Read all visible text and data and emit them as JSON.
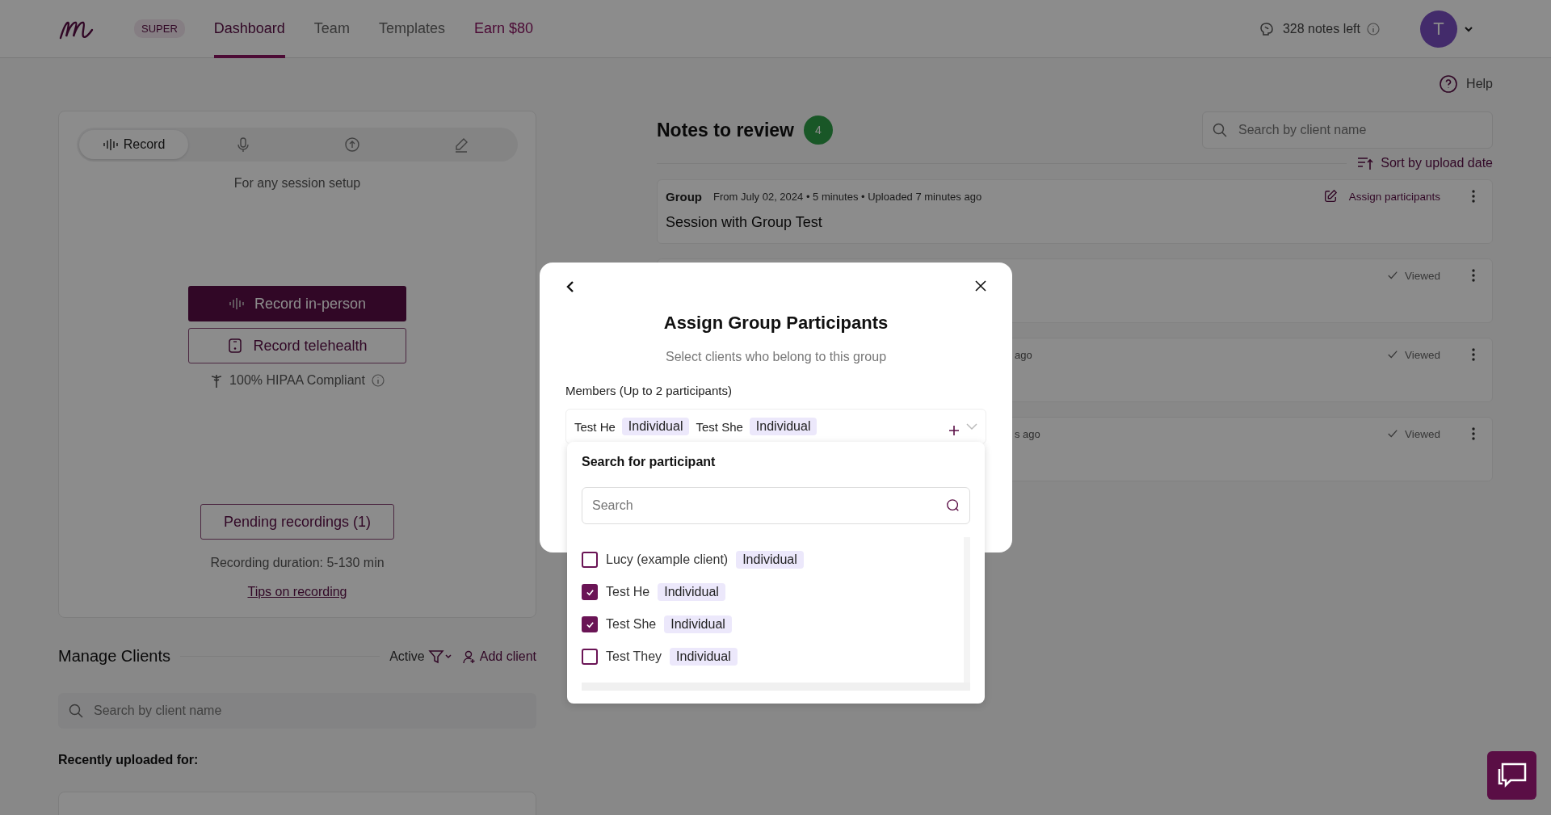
{
  "nav": {
    "badge": "SUPER",
    "tabs": [
      {
        "label": "Dashboard",
        "selected": true
      },
      {
        "label": "Team",
        "selected": false
      },
      {
        "label": "Templates",
        "selected": false
      }
    ],
    "promo_link": "Earn $80",
    "notes_left": "328 notes left",
    "avatar": "T"
  },
  "help": "Help",
  "recorder": {
    "modes": [
      {
        "kind": "waveform",
        "label": "Record",
        "selected": true
      },
      {
        "kind": "mic",
        "selected": false
      },
      {
        "kind": "upload",
        "selected": false
      },
      {
        "kind": "pen",
        "selected": false
      }
    ],
    "caption": "For any session setup",
    "primary_button": "Record in-person",
    "secondary_button": "Record telehealth",
    "compliance": "100% HIPAA Compliant",
    "pending_button": "Pending recordings (1)",
    "duration": "Recording duration: 5-130 min",
    "tips_link": "Tips on recording"
  },
  "clients": {
    "title": "Manage Clients",
    "filter": "Active",
    "add_button": "Add client",
    "search": {
      "placeholder": "Search by client name"
    },
    "recent_label": "Recently uploaded for:"
  },
  "notes": {
    "title": "Notes to review",
    "count": "4",
    "search": {
      "placeholder": "Search by client name"
    },
    "sort": "Sort by upload date",
    "items": [
      {
        "type": "Group",
        "meta": "From July 02, 2024 • 5 minutes • Uploaded 7 minutes ago",
        "title": "Session with Group Test",
        "action": "Assign participants"
      },
      {
        "status": "Viewed"
      },
      {
        "meta_tail": "ago",
        "status": "Viewed"
      },
      {
        "meta_tail": "s ago",
        "status": "Viewed"
      }
    ]
  },
  "modal": {
    "title": "Assign Group Participants",
    "subtitle": "Select clients who belong to this group",
    "members_label": "Members (Up to 2 participants)",
    "members": [
      {
        "name": "Test He",
        "tag": "Individual"
      },
      {
        "name": "Test She",
        "tag": "Individual"
      }
    ],
    "dropdown": {
      "title": "Search for participant",
      "search": {
        "placeholder": "Search"
      },
      "options": [
        {
          "name": "Lucy (example client)",
          "tag": "Individual",
          "checked": false
        },
        {
          "name": "Test He",
          "tag": "Individual",
          "checked": true
        },
        {
          "name": "Test She",
          "tag": "Individual",
          "checked": true
        },
        {
          "name": "Test They",
          "tag": "Individual",
          "checked": false
        }
      ]
    }
  }
}
